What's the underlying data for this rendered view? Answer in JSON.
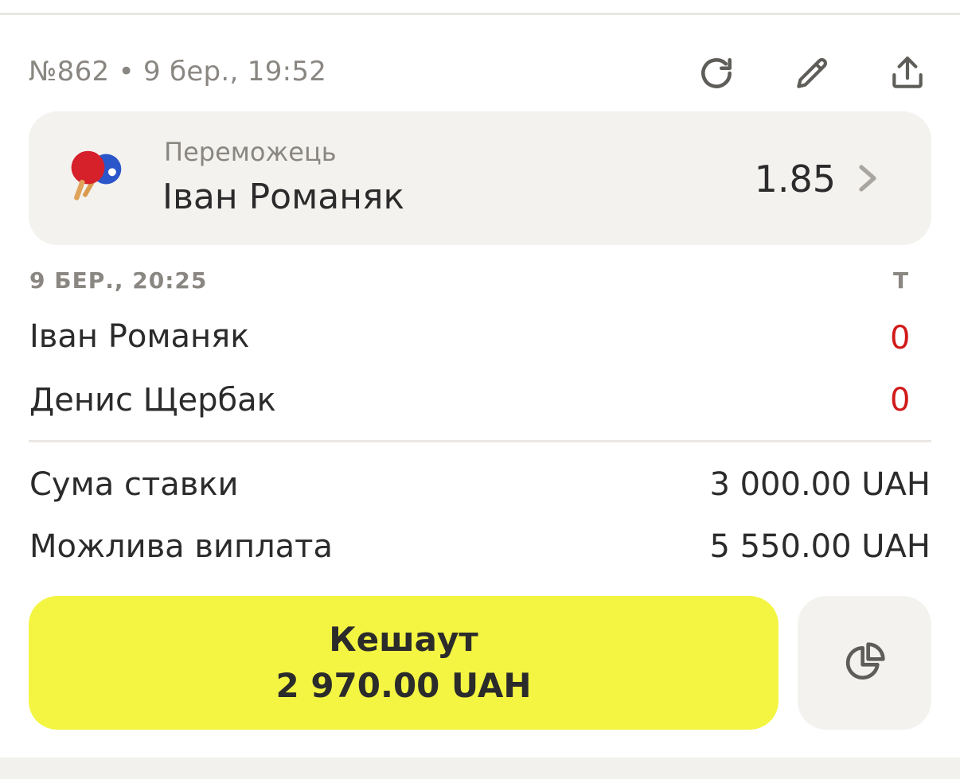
{
  "bet": {
    "meta": "№862 • 9 бер., 19:52"
  },
  "selection": {
    "market": "Переможець",
    "name": "Іван Романяк",
    "odds": "1.85"
  },
  "event": {
    "date": "9 БЕР., 20:25",
    "score_column": "Т",
    "players": [
      {
        "name": "Іван Романяк",
        "score": "0"
      },
      {
        "name": "Денис Щербак",
        "score": "0"
      }
    ]
  },
  "summary": {
    "stake_label": "Сума ставки",
    "stake_value": "3 000.00 UAH",
    "payout_label": "Можлива виплата",
    "payout_value": "5 550.00 UAH"
  },
  "cashout": {
    "label": "Кешаут",
    "amount": "2 970.00 UAH"
  },
  "icons": {
    "refresh": "refresh-icon",
    "edit": "pencil-icon",
    "share": "share-icon",
    "sport": "table-tennis-icon",
    "chevron": "chevron-right-icon",
    "partial": "pie-chart-icon"
  },
  "colors": {
    "cashout_bg": "#f3f542",
    "score": "#d11a1a",
    "muted_text": "#8a8782",
    "panel_bg": "#f3f2ef"
  }
}
